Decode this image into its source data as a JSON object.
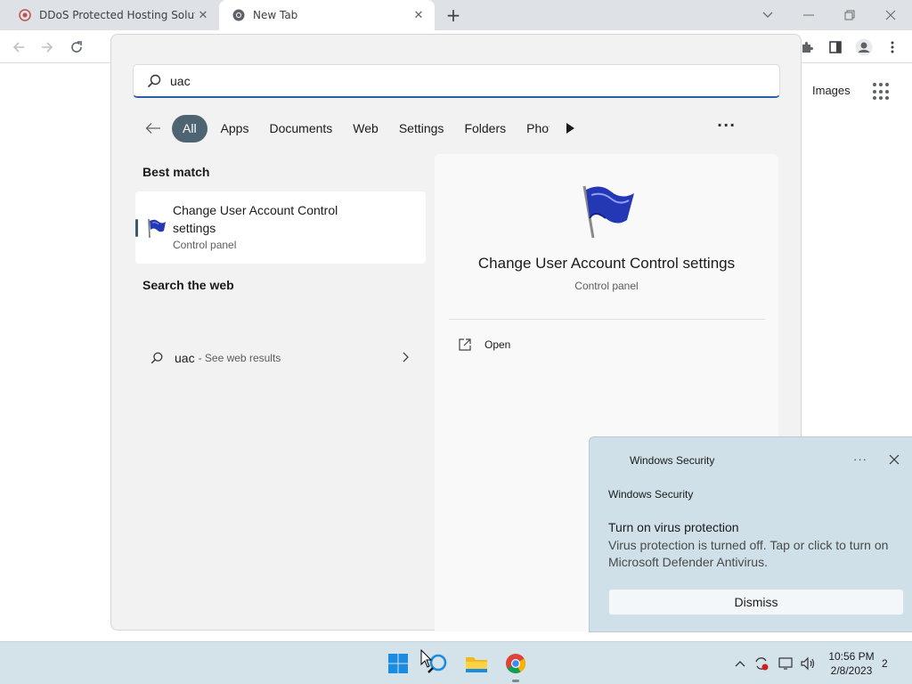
{
  "browser": {
    "tabs": [
      {
        "title": "DDoS Protected Hosting Solutions"
      },
      {
        "title": "New Tab"
      }
    ],
    "page_links": {
      "images": "Images"
    }
  },
  "search": {
    "query": "uac",
    "filters": [
      "All",
      "Apps",
      "Documents",
      "Web",
      "Settings",
      "Folders",
      "Photos"
    ],
    "active_filter": "All",
    "best_match_heading": "Best match",
    "best_match": {
      "title": "Change User Account Control settings",
      "subtitle": "Control panel"
    },
    "web_heading": "Search the web",
    "web_result": {
      "query": "uac",
      "suffix": "- See web results"
    },
    "detail": {
      "title": "Change User Account Control settings",
      "subtitle": "Control panel",
      "actions": [
        {
          "label": "Open"
        }
      ]
    }
  },
  "notification": {
    "app_name": "Windows Security",
    "source": "Windows Security",
    "heading": "Turn on virus protection",
    "body": "Virus protection is turned off. Tap or click to turn on Microsoft Defender Antivirus.",
    "dismiss_label": "Dismiss"
  },
  "taskbar": {
    "time": "10:56 PM",
    "date": "2/8/2023",
    "notification_count": "2"
  },
  "colors": {
    "taskbar_bg": "#d4e3ea",
    "active_chip": "#4f6472",
    "search_accent": "#2d5fa7",
    "toast_bg": "#cfe0e8"
  }
}
